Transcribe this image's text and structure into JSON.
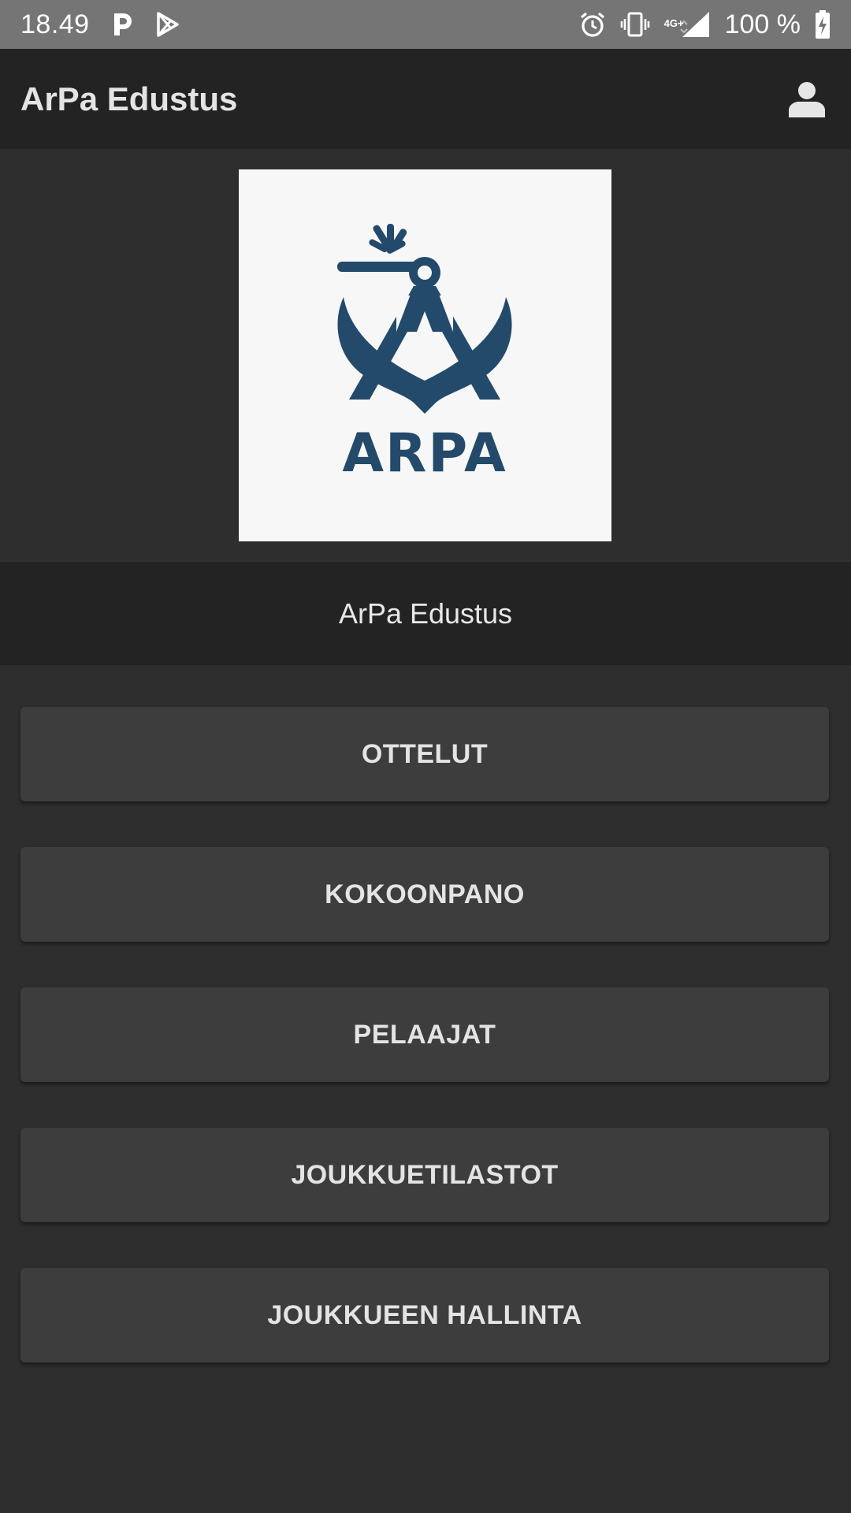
{
  "status_bar": {
    "time": "18.49",
    "network": "4G+",
    "battery_text": "100 %",
    "icons": [
      "p-app-icon",
      "play-store-icon",
      "alarm-icon",
      "vibrate-icon",
      "signal-icon",
      "battery-charging-icon"
    ]
  },
  "app_bar": {
    "title": "ArPa Edustus",
    "account_icon": "account-icon"
  },
  "logo": {
    "text": "ARPA",
    "color": "#244a6b"
  },
  "team_band": {
    "name": "ArPa Edustus"
  },
  "menu": {
    "items": [
      {
        "label": "OTTELUT"
      },
      {
        "label": "KOKOONPANO"
      },
      {
        "label": "PELAAJAT"
      },
      {
        "label": "JOUKKUETILASTOT"
      },
      {
        "label": "JOUKKUEEN HALLINTA"
      }
    ]
  },
  "colors": {
    "background": "#2e2e2e",
    "app_bar": "#232323",
    "button": "#3d3d3d",
    "status_bar": "#757575"
  }
}
